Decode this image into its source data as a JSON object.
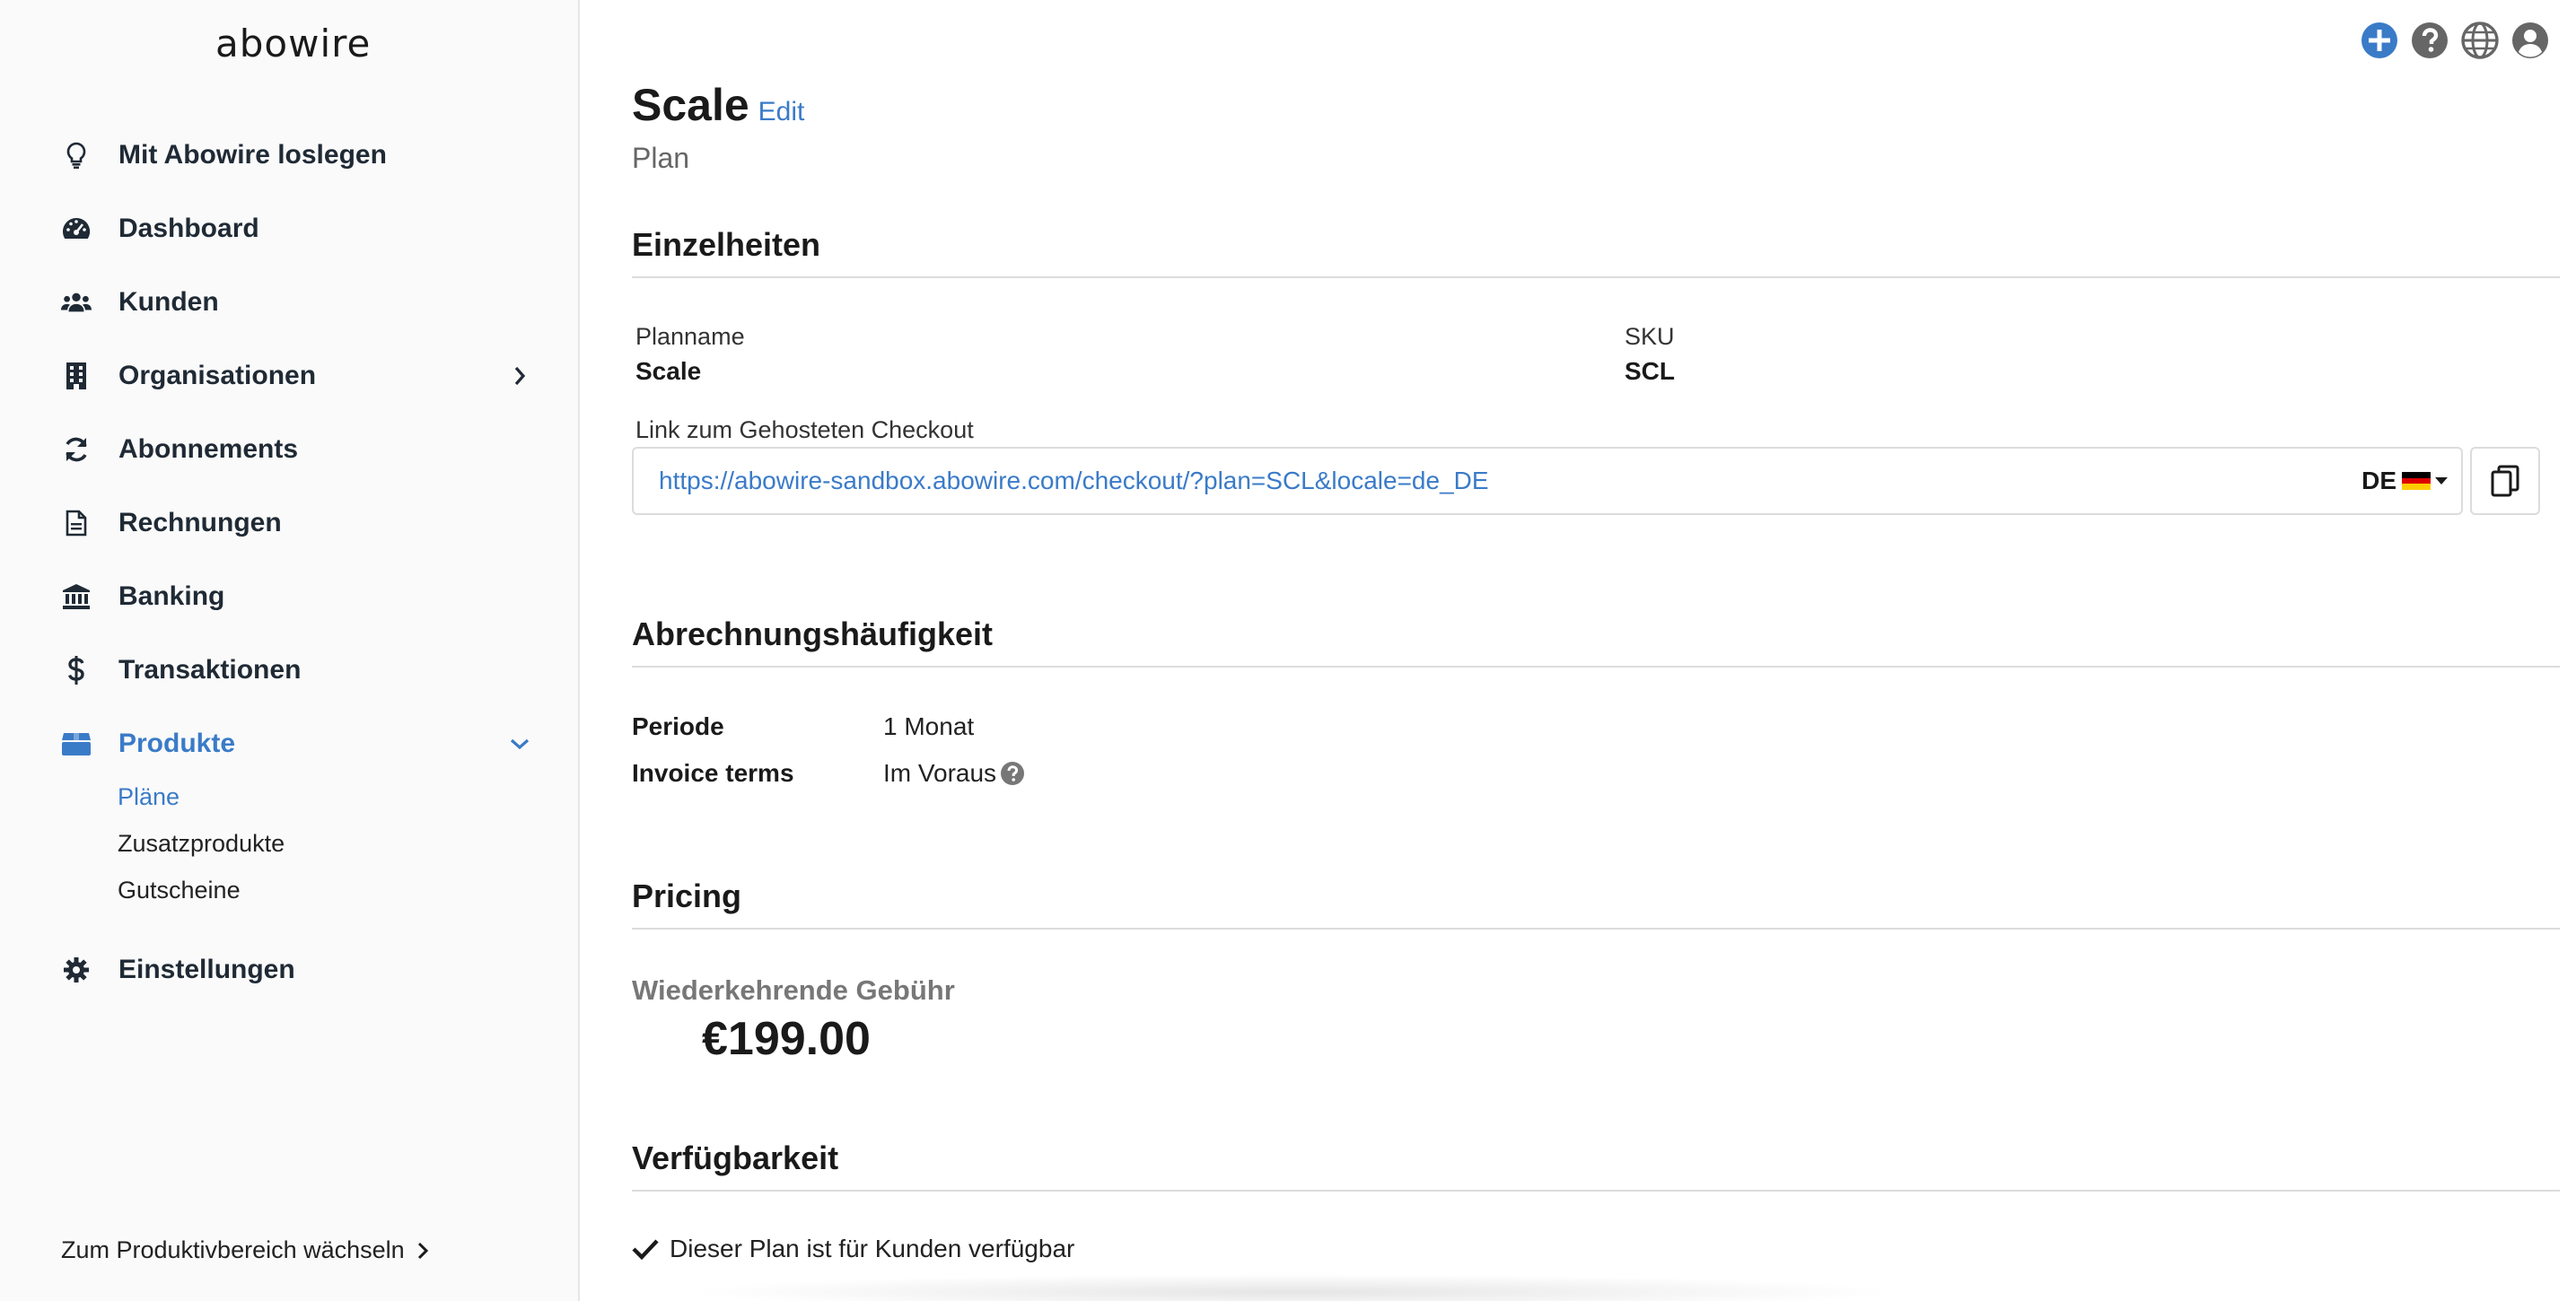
{
  "app": {
    "logo": "abowire"
  },
  "sidebar": {
    "items": [
      {
        "label": "Mit Abowire loslegen",
        "icon": "lightbulb-icon"
      },
      {
        "label": "Dashboard",
        "icon": "dashboard-gauge-icon"
      },
      {
        "label": "Kunden",
        "icon": "users-icon"
      },
      {
        "label": "Organisationen",
        "icon": "building-icon"
      },
      {
        "label": "Abonnements",
        "icon": "sync-icon"
      },
      {
        "label": "Rechnungen",
        "icon": "document-icon"
      },
      {
        "label": "Banking",
        "icon": "bank-icon"
      },
      {
        "label": "Transaktionen",
        "icon": "dollar-icon"
      },
      {
        "label": "Produkte",
        "icon": "box-icon"
      },
      {
        "label": "Einstellungen",
        "icon": "gear-icon"
      }
    ],
    "sub_items": [
      {
        "label": "Pläne"
      },
      {
        "label": "Zusatzprodukte"
      },
      {
        "label": "Gutscheine"
      }
    ],
    "switch_label": "Zum Produktivbereich wächseln"
  },
  "header": {
    "icons": [
      "plus-circle-icon",
      "help-icon",
      "globe-icon",
      "user-avatar-icon"
    ]
  },
  "page": {
    "title": "Scale",
    "edit_label": "Edit",
    "subtitle": "Plan"
  },
  "details": {
    "heading": "Einzelheiten",
    "plan_name_label": "Planname",
    "plan_name_value": "Scale",
    "sku_label": "SKU",
    "sku_value": "SCL",
    "checkout_label": "Link zum Gehosteten Checkout",
    "checkout_url": "https://abowire-sandbox.abowire.com/checkout/?plan=SCL&locale=de_DE",
    "locale_code": "DE"
  },
  "billing": {
    "heading": "Abrechnungshäufigkeit",
    "period_label": "Periode",
    "period_value": "1 Monat",
    "terms_label": "Invoice terms",
    "terms_value": "Im Voraus"
  },
  "pricing": {
    "heading": "Pricing",
    "fee_label": "Wiederkehrende Gebühr",
    "fee_value": "€199.00"
  },
  "availability": {
    "heading": "Verfügbarkeit",
    "line1": "Dieser Plan ist für Kunden verfügbar"
  },
  "colors": {
    "accent": "#3a7bc8",
    "text": "#1f2a35",
    "border": "#dcdcdc"
  }
}
